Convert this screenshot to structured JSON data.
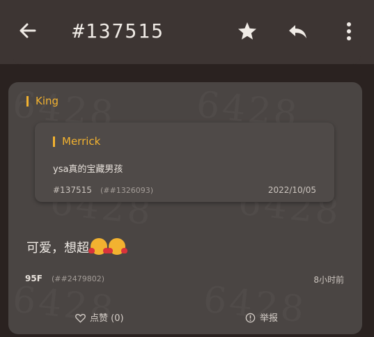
{
  "header": {
    "title": "#137515",
    "icons": [
      "back-arrow-icon",
      "star-icon",
      "reply-icon",
      "more-vertical-icon"
    ]
  },
  "watermark": "6428",
  "post": {
    "author": "King",
    "quote": {
      "author": "Merrick",
      "text": "ysa真的宝藏男孩",
      "id": "#137515",
      "ref": "(##1326093)",
      "date": "2022/10/05"
    },
    "text": "可爱，想超",
    "emojis": [
      "smiling-face-with-hearts-emoji",
      "smiling-face-with-hearts-emoji"
    ],
    "floor": "95F",
    "floor_ref": "(##2479802)",
    "time": "8小时前",
    "like_label": "点赞 (0)",
    "report_label": "举报"
  },
  "colors": {
    "accent": "#f2b230",
    "header_bg": "#3d3533",
    "card_bg": "#4a4543",
    "page_bg": "#2a2220"
  }
}
